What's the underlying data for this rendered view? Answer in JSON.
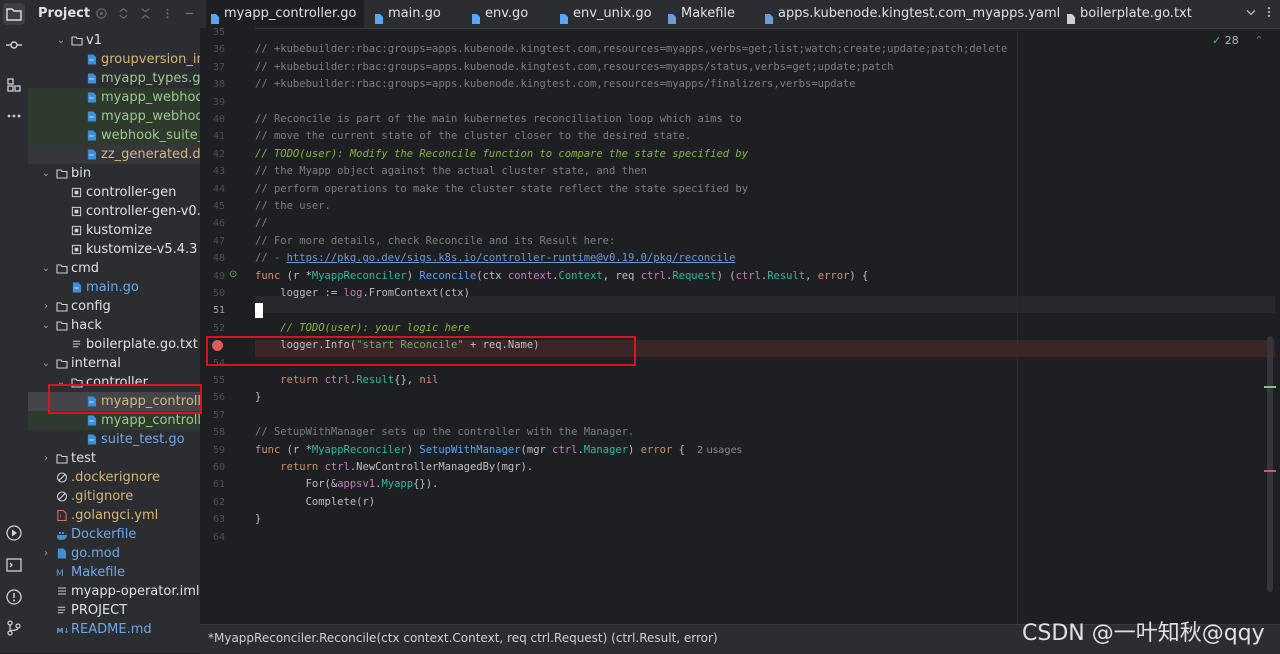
{
  "project": {
    "title": "Project",
    "tree": [
      {
        "label": "v1",
        "type": "folder",
        "open": true,
        "depth": 3
      },
      {
        "label": "groupversion_info.go",
        "type": "go",
        "depth": 4
      },
      {
        "label": "myapp_types.go",
        "type": "go",
        "depth": 4
      },
      {
        "label": "myapp_webhook.go",
        "type": "go",
        "depth": 4
      },
      {
        "label": "myapp_webhook_test.go",
        "type": "go",
        "depth": 4
      },
      {
        "label": "webhook_suite_test.go",
        "type": "go",
        "depth": 4
      },
      {
        "label": "zz_generated.deepcopy.go",
        "type": "go",
        "depth": 4
      },
      {
        "label": "bin",
        "type": "folder",
        "open": true,
        "depth": 2
      },
      {
        "label": "controller-gen",
        "type": "bin",
        "depth": 3
      },
      {
        "label": "controller-gen-v0.",
        "type": "bin",
        "depth": 3
      },
      {
        "label": "kustomize",
        "type": "bin",
        "depth": 3
      },
      {
        "label": "kustomize-v5.4.3",
        "type": "bin",
        "depth": 3
      },
      {
        "label": "cmd",
        "type": "folder",
        "open": true,
        "depth": 2
      },
      {
        "label": "main.go",
        "type": "go",
        "depth": 3
      },
      {
        "label": "config",
        "type": "folder",
        "open": false,
        "depth": 2
      },
      {
        "label": "hack",
        "type": "folder",
        "open": true,
        "depth": 2
      },
      {
        "label": "boilerplate.go.txt",
        "type": "txt",
        "depth": 3
      },
      {
        "label": "internal",
        "type": "folder",
        "open": true,
        "depth": 2
      },
      {
        "label": "controller",
        "type": "folder",
        "open": true,
        "depth": 3
      },
      {
        "label": "myapp_controller.go",
        "type": "go",
        "depth": 4,
        "selected": true
      },
      {
        "label": "myapp_controller_test.go",
        "type": "go",
        "depth": 4
      },
      {
        "label": "suite_test.go",
        "type": "go",
        "depth": 4
      },
      {
        "label": "test",
        "type": "folder",
        "open": false,
        "depth": 2
      },
      {
        "label": ".dockerignore",
        "type": "ignore",
        "depth": 2
      },
      {
        "label": ".gitignore",
        "type": "ignore",
        "depth": 2
      },
      {
        "label": ".golangci.yml",
        "type": "yml",
        "depth": 2
      },
      {
        "label": "Dockerfile",
        "type": "docker",
        "depth": 2
      },
      {
        "label": "go.mod",
        "type": "gomod",
        "depth": 2,
        "collapsed": true
      },
      {
        "label": "Makefile",
        "type": "make",
        "depth": 2
      },
      {
        "label": "myapp-operator.iml",
        "type": "iml",
        "depth": 2
      },
      {
        "label": "PROJECT",
        "type": "txt",
        "depth": 2
      },
      {
        "label": "README.md",
        "type": "md",
        "depth": 2
      }
    ]
  },
  "tabs": [
    {
      "label": "myapp_controller.go",
      "active": true
    },
    {
      "label": "main.go"
    },
    {
      "label": "env.go"
    },
    {
      "label": "env_unix.go"
    },
    {
      "label": "Makefile"
    },
    {
      "label": "apps.kubenode.kingtest.com_myapps.yaml"
    },
    {
      "label": "boilerplate.go.txt"
    }
  ],
  "editor": {
    "inspection_count": "28",
    "usages_hint": "2 usages",
    "line_numbers": [
      "35",
      "36",
      "37",
      "38",
      "39",
      "40",
      "41",
      "42",
      "43",
      "44",
      "45",
      "46",
      "47",
      "48",
      "49",
      "50",
      "51",
      "52",
      "53",
      "54",
      "55",
      "56",
      "57",
      "58",
      "59",
      "60",
      "61",
      "62",
      "63",
      "64"
    ],
    "breakpoint_line": "53",
    "current_line": "51"
  },
  "code": [
    "",
    "// +kubebuilder:rbac:groups=apps.kubenode.kingtest.com,resources=myapps,verbs=get;list;watch;create;update;patch;delete",
    "// +kubebuilder:rbac:groups=apps.kubenode.kingtest.com,resources=myapps/status,verbs=get;update;patch",
    "// +kubebuilder:rbac:groups=apps.kubenode.kingtest.com,resources=myapps/finalizers,verbs=update",
    "",
    "// Reconcile is part of the main kubernetes reconciliation loop which aims to",
    "// move the current state of the cluster closer to the desired state.",
    "// TODO(user): Modify the Reconcile function to compare the state specified by",
    "// the Myapp object against the actual cluster state, and then",
    "// perform operations to make the cluster state reflect the state specified by",
    "// the user.",
    "//",
    "// For more details, check Reconcile and its Result here:",
    "// - https://pkg.go.dev/sigs.k8s.io/controller-runtime@v0.19.0/pkg/reconcile",
    "func (r *MyappReconciler) Reconcile(ctx context.Context, req ctrl.Request) (ctrl.Result, error) {",
    "    logger := log.FromContext(ctx)",
    "",
    "    // TODO(user): your logic here",
    "    logger.Info(\"start Reconcile\" + req.Name)",
    "",
    "    return ctrl.Result{}, nil",
    "}",
    "",
    "// SetupWithManager sets up the controller with the Manager.",
    "func (r *MyappReconciler) SetupWithManager(mgr ctrl.Manager) error {",
    "    return ctrl.NewControllerManagedBy(mgr).",
    "        For(&appsv1.Myapp{}).",
    "        Complete(r)",
    "}",
    ""
  ],
  "status": {
    "breadcrumb": "*MyappReconciler.Reconcile(ctx context.Context, req ctrl.Request) (ctrl.Result, error)",
    "watermark": "CSDN @一叶知秋@qqy"
  },
  "colors": {
    "accent": "#3574f0",
    "breakpoint": "#db5c5c",
    "highlight_box": "#d9141c",
    "go_file": "#56a8f5",
    "modified_green": "#7ec27e"
  }
}
